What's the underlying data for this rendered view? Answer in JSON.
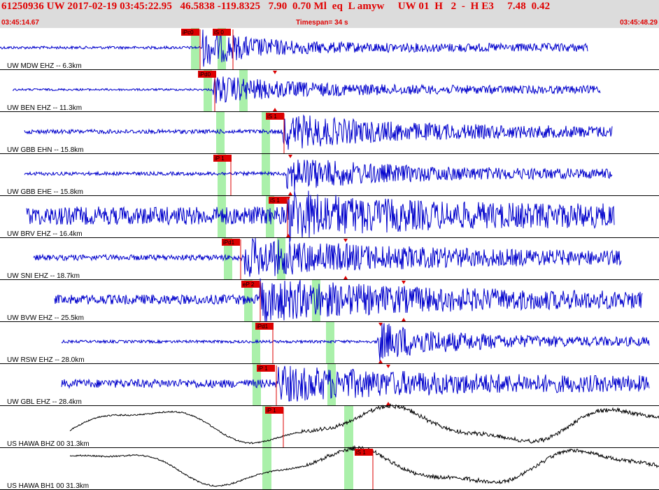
{
  "header": {
    "event_line": "61250936 UW 2017-02-19 03:45:22.95   46.5838 -119.8325   7.90  0.70 Ml  eq  L amyw     UW 01  H   2  -  H E3     7.48  0.42",
    "start_time": "03:45:14.67",
    "timespan": "Timespan=  34 s",
    "end_time": "03:45:48.29"
  },
  "colors": {
    "trace": "#0000cc",
    "trace_long_period": "#000000",
    "pick": "#dd0000",
    "window": "#aaf0aa",
    "header_text": "#e00000"
  },
  "traces": [
    {
      "label": "UW MDW EHZ -- 6.3km",
      "color": "blue",
      "picks": [
        {
          "text": "iPc0"
        },
        {
          "text": "iS 0"
        }
      ]
    },
    {
      "label": "UW BEN EHZ -- 11.3km",
      "color": "blue",
      "picks": [
        {
          "text": "iPd0"
        }
      ]
    },
    {
      "label": "UW GBB EHN -- 15.8km",
      "color": "blue",
      "picks": [
        {
          "text": "iS 1"
        }
      ]
    },
    {
      "label": "UW GBB EHE -- 15.8km",
      "color": "blue",
      "picks": [
        {
          "text": "iP 1"
        }
      ]
    },
    {
      "label": "UW BRV EHZ -- 16.4km",
      "color": "blue",
      "picks": [
        {
          "text": "iS 1"
        }
      ]
    },
    {
      "label": "UW SNI EHZ -- 18.7km",
      "color": "blue",
      "picks": [
        {
          "text": "iPd1"
        }
      ]
    },
    {
      "label": "UW BVW EHZ -- 25.5km",
      "color": "blue",
      "picks": [
        {
          "text": "eP 2"
        }
      ]
    },
    {
      "label": "UW RSW EHZ -- 28.0km",
      "color": "blue",
      "picks": [
        {
          "text": "iPd1"
        }
      ]
    },
    {
      "label": "UW GBL EHZ -- 28.4km",
      "color": "blue",
      "picks": [
        {
          "text": "iP 1"
        }
      ]
    },
    {
      "label": "US HAWA BHZ 00 31.3km",
      "color": "black",
      "picks": [
        {
          "text": "iP 1"
        }
      ]
    },
    {
      "label": "US HAWA BH1 00 31.3km",
      "color": "black",
      "picks": [
        {
          "text": "iS 1"
        }
      ]
    }
  ]
}
